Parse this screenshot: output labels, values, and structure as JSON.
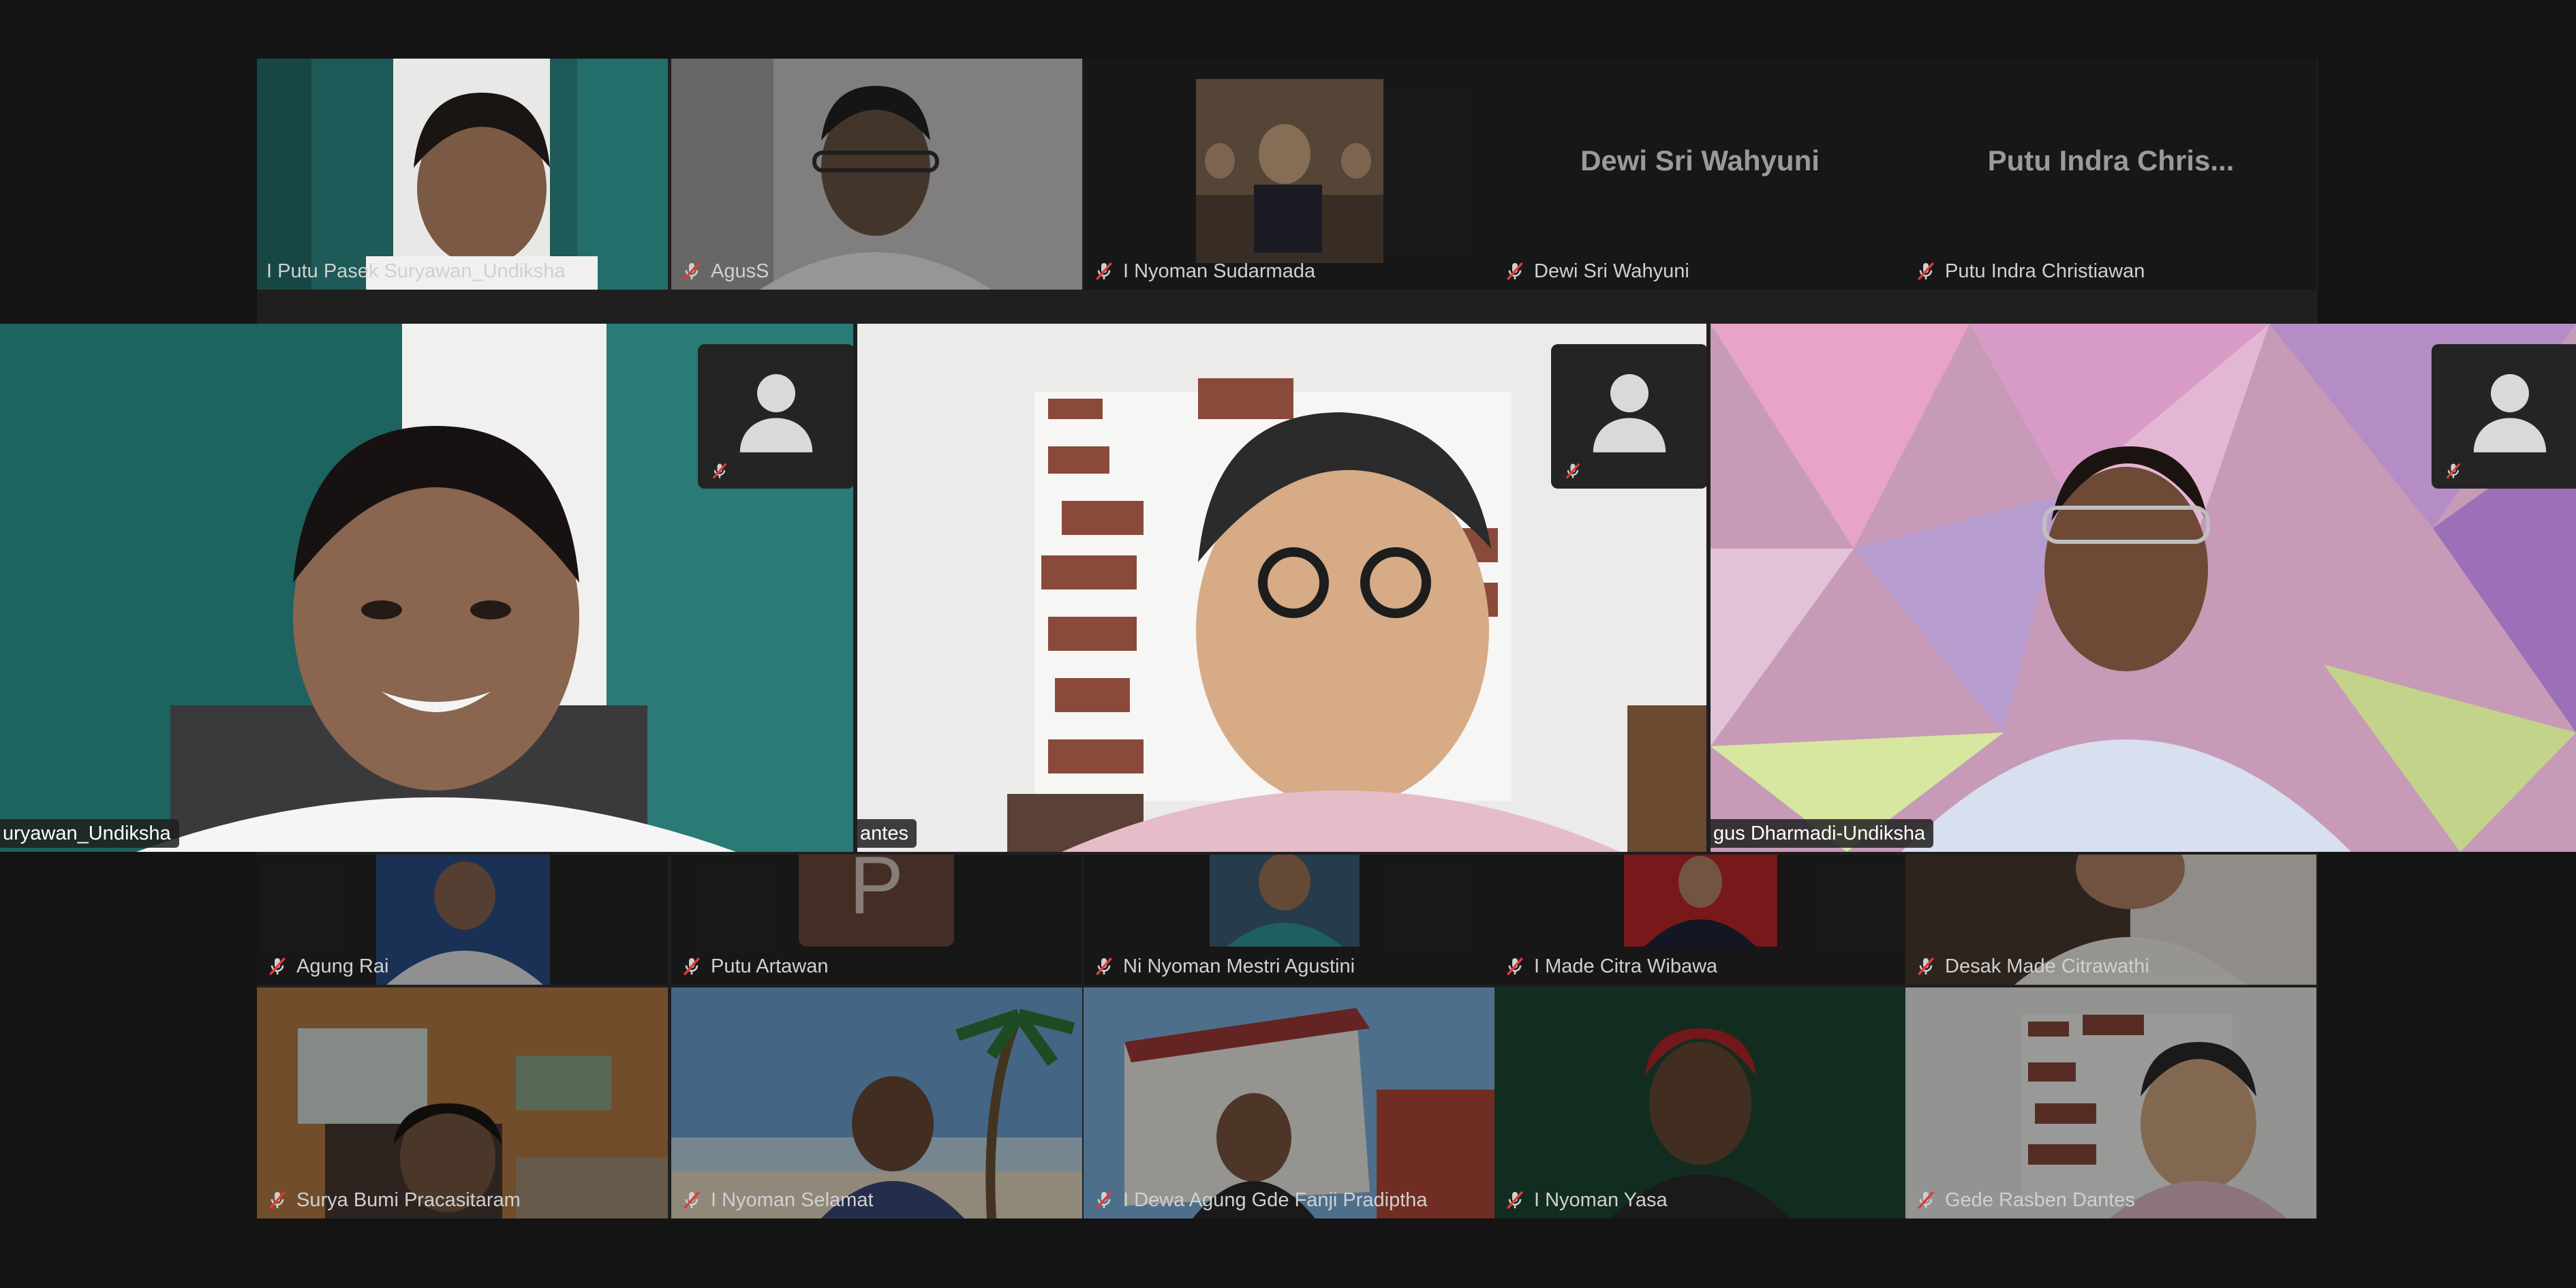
{
  "meeting": {
    "gallery_top": [
      {
        "name": "I Putu Pasek Suryawan_Undiksha",
        "muted": false,
        "active": true
      },
      {
        "name": "AgusS",
        "muted": true
      },
      {
        "name": "I Nyoman Sudarmada",
        "muted": true
      },
      {
        "name": "Dewi Sri Wahyuni",
        "muted": true,
        "display_name": "Dewi Sri Wahyuni"
      },
      {
        "name": "Putu Indra Christiawan",
        "muted": true,
        "display_name": "Putu Indra Chris..."
      }
    ],
    "spotlight": [
      {
        "label": "uryawan_Undiksha"
      },
      {
        "label": "antes"
      },
      {
        "label": "gus Dharmadi-Undiksha"
      }
    ],
    "gallery_mid": [
      {
        "name": "Agung Rai",
        "muted": true
      },
      {
        "name": "Putu Artawan",
        "muted": true,
        "initial": "P"
      },
      {
        "name": "Ni Nyoman Mestri Agustini",
        "muted": true
      },
      {
        "name": "I Made Citra Wibawa",
        "muted": true
      },
      {
        "name": "Desak Made Citrawathi",
        "muted": true
      }
    ],
    "gallery_bottom": [
      {
        "name": "Surya Bumi Pracasitaram",
        "muted": true
      },
      {
        "name": "I Nyoman Selamat",
        "muted": true
      },
      {
        "name": "I Dewa Agung Gde Fanji Pradiptha",
        "muted": true
      },
      {
        "name": "I Nyoman Yasa",
        "muted": true
      },
      {
        "name": "Gede Rasben Dantes",
        "muted": true
      }
    ],
    "colors": {
      "background": "#141414",
      "tile": "#262626",
      "active_border": "#2e9e5a",
      "muted_icon": "#e03a3a"
    }
  }
}
